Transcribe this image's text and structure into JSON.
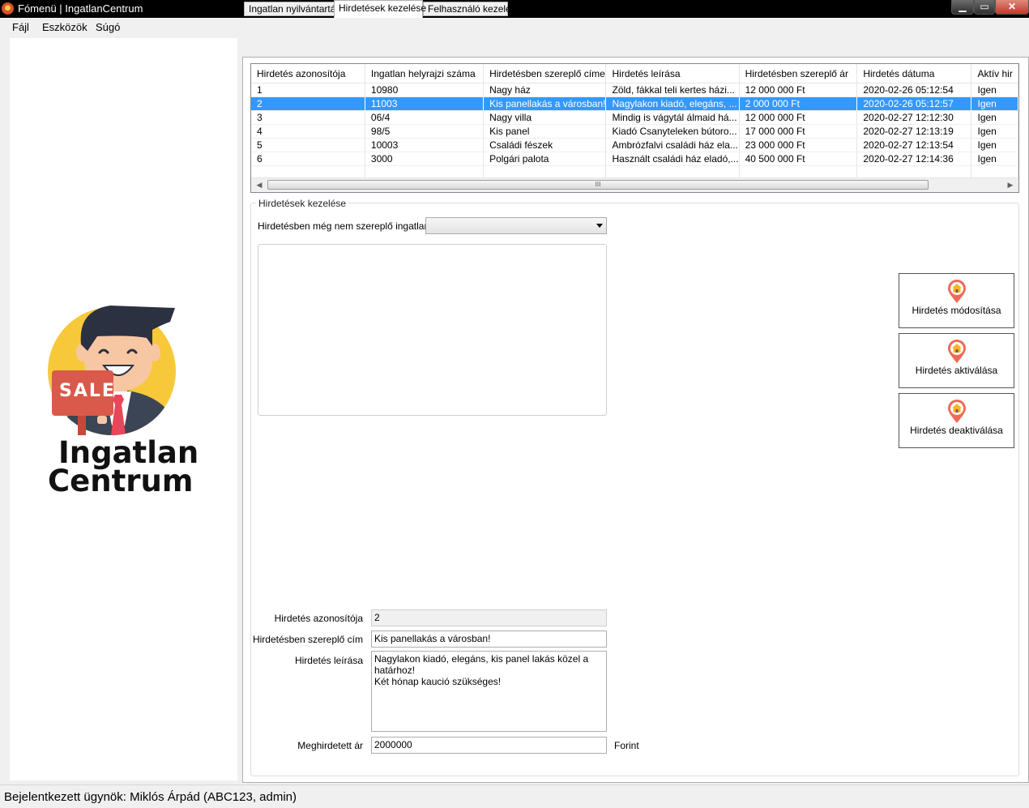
{
  "window": {
    "title": "Fómenü | IngatlanCentrum",
    "minimize": "▁",
    "maximize": "▭",
    "close": "✕"
  },
  "menu": {
    "items": [
      "Fájl",
      "Eszközök",
      "Súgó"
    ]
  },
  "logo": {
    "badge": "SALE",
    "line1": "Ingatlan",
    "line2": "Centrum",
    "colors": {
      "circle": "#f7c93a",
      "sign": "#d95a4a",
      "suit": "#3b4556",
      "tie": "#e8465a",
      "hair": "#2b3140",
      "skin": "#f7c7a3"
    }
  },
  "tabs": [
    {
      "label": "Ingatlan nyilvántartás",
      "active": false
    },
    {
      "label": "Hirdetések kezelése",
      "active": true
    },
    {
      "label": "Felhasználó kezelés",
      "active": false
    }
  ],
  "grid": {
    "columns": [
      "Hirdetés azonosítója",
      "Ingatlan helyrajzi száma",
      "Hirdetésben szereplő címe",
      "Hirdetés leírása",
      "Hirdetésben szereplő ár",
      "Hirdetés dátuma",
      "Aktív hir"
    ],
    "rows": [
      [
        "1",
        "10980",
        "Nagy ház",
        "Zöld, fákkal teli kertes házi...",
        "12 000 000 Ft",
        "2020-02-26 05:12:54",
        "Igen"
      ],
      [
        "2",
        "11003",
        "Kis panellakás a városban!",
        "Nagylakon kiadó, elegáns, ...",
        "2 000 000 Ft",
        "2020-02-26 05:12:57",
        "Igen"
      ],
      [
        "3",
        "06/4",
        "Nagy villa",
        "Mindig is vágytál álmaid há...",
        "12 000 000 Ft",
        "2020-02-27 12:12:30",
        "Igen"
      ],
      [
        "4",
        "98/5",
        "Kis panel",
        "Kiadó Csanyteleken bútoro...",
        "17 000 000 Ft",
        "2020-02-27 12:13:19",
        "Igen"
      ],
      [
        "5",
        "10003",
        "Családi fészek",
        "Ambrózfalvi családi ház ela...",
        "23 000 000 Ft",
        "2020-02-27 12:13:54",
        "Igen"
      ],
      [
        "6",
        "3000",
        "Polgári palota",
        "Használt családi ház eladó,...",
        "40 500 000 Ft",
        "2020-02-27 12:14:36",
        "Igen"
      ]
    ],
    "selected_row": 1,
    "selection_color": "#3399ff",
    "scroll": {
      "left": "◀",
      "right": "▶",
      "grip": "III"
    }
  },
  "group": {
    "title": "Hirdetések kezelése",
    "combo_label": "Hirdetésben még nem szereplő ingatlanok",
    "combo_value": ""
  },
  "buttons": {
    "modify": "Hirdetés módosítása",
    "activate": "Hirdetés aktiválása",
    "deactivate": "Hirdetés deaktiválása"
  },
  "form": {
    "id_label": "Hirdetés azonosítója",
    "id_value": "2",
    "title_label": "Hirdetésben szereplő cím",
    "title_value": "Kis panellakás a városban!",
    "desc_label": "Hirdetés leírása",
    "desc_value": "Nagylakon kiadó, elegáns, kis panel lakás közel a határhoz!\nKét hónap kaució szükséges!",
    "price_label": "Meghirdetett ár",
    "price_value": "2000000",
    "currency": "Forint"
  },
  "status": {
    "text": "Bejelentkezett ügynök: Miklós Árpád (ABC123, admin)"
  }
}
